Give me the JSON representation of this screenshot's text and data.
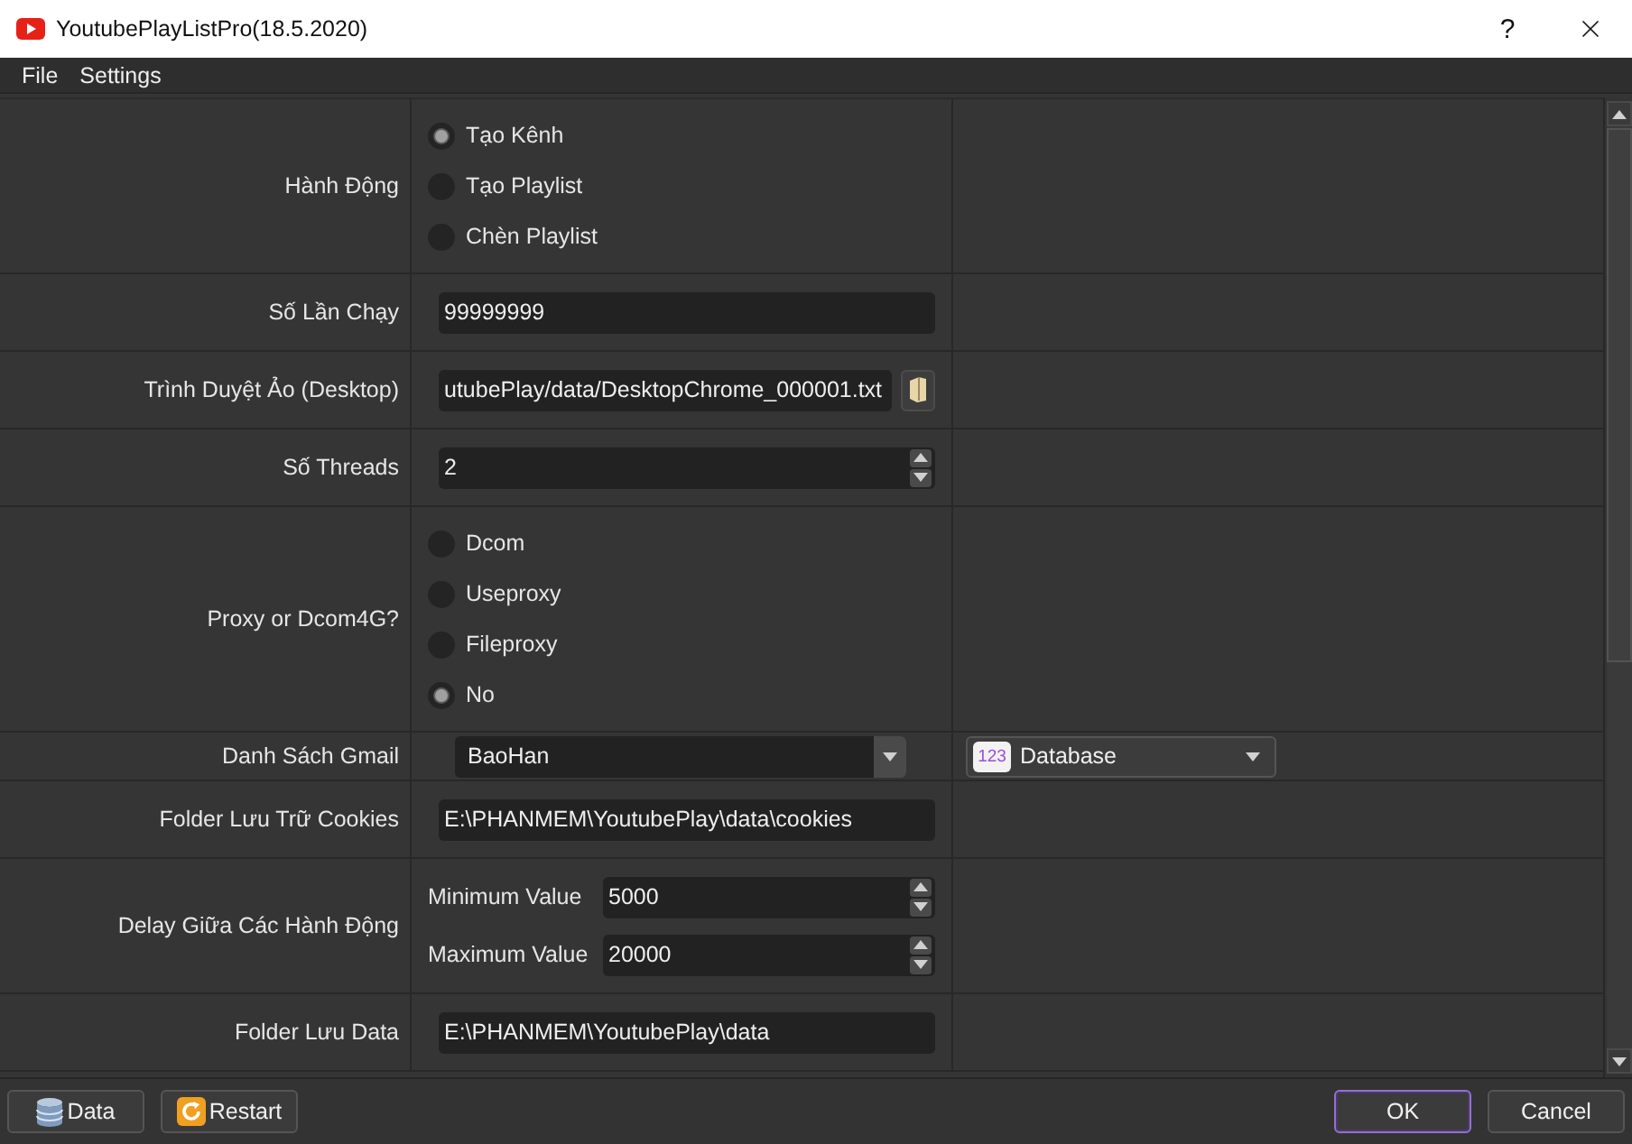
{
  "window": {
    "title": "YoutubePlayListPro(18.5.2020)",
    "help": "?"
  },
  "menu": [
    {
      "label": "File"
    },
    {
      "label": "Settings"
    }
  ],
  "rows": [
    {
      "kind": "radio",
      "label": "Hành Động",
      "options": [
        {
          "label": "Tạo Kênh",
          "selected": true
        },
        {
          "label": "Tạo Playlist",
          "selected": false
        },
        {
          "label": "Chèn Playlist",
          "selected": false
        }
      ]
    },
    {
      "kind": "text",
      "label": "Số Lần Chạy",
      "value": "99999999"
    },
    {
      "kind": "file",
      "label": "Trình Duyệt Ảo (Desktop)",
      "value": "utubePlay/data/DesktopChrome_000001.txt"
    },
    {
      "kind": "spin",
      "label": "Số Threads",
      "value": "2"
    },
    {
      "kind": "radio",
      "label": "Proxy or Dcom4G?",
      "options": [
        {
          "label": "Dcom",
          "selected": false
        },
        {
          "label": "Useproxy",
          "selected": false
        },
        {
          "label": "Fileproxy",
          "selected": false
        },
        {
          "label": "No",
          "selected": true
        }
      ]
    },
    {
      "kind": "combo",
      "label": "Danh Sách Gmail",
      "value": "BaoHan",
      "extra": {
        "icon_text": "123",
        "value": "Database"
      }
    },
    {
      "kind": "text",
      "label": "Folder Lưu Trữ Cookies",
      "value": "E:\\PHANMEM\\YoutubePlay\\data\\cookies"
    },
    {
      "kind": "range",
      "label": "Delay Giữa Các Hành Động",
      "fields": [
        {
          "label": "Minimum Value",
          "value": "5000"
        },
        {
          "label": "Maximum Value",
          "value": "20000"
        }
      ]
    },
    {
      "kind": "text",
      "label": "Folder Lưu Data",
      "value": "E:\\PHANMEM\\YoutubePlay\\data"
    }
  ],
  "footer": {
    "left": [
      {
        "label": "Data",
        "kind": "database",
        "focused": false
      },
      {
        "label": "Restart",
        "kind": "restart",
        "focused": false
      }
    ],
    "right": [
      {
        "label": "OK",
        "focused": true
      },
      {
        "label": "Cancel",
        "focused": false
      }
    ]
  }
}
